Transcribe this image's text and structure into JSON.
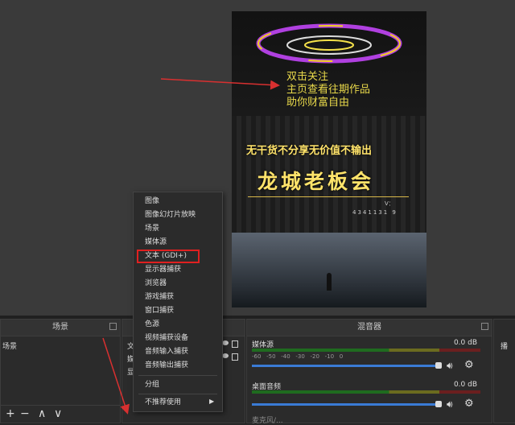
{
  "overlay_text": {
    "line1": "双击关注",
    "line2": "主页查看往期作品",
    "line3": "助你财富自由"
  },
  "banner": {
    "slogan": "无干货不分享无价值不输出",
    "title": "龙城老板会",
    "contact_label": "V：",
    "contact_number": "4341131 9"
  },
  "scenes_panel": {
    "title": "场景",
    "item": "场景",
    "buttons": [
      "+",
      "−",
      "∧",
      "∨"
    ]
  },
  "sources_panel": {
    "items": [
      "文",
      "媒",
      "显"
    ]
  },
  "mixer": {
    "title": "混音器",
    "channels": [
      {
        "name": "媒体源",
        "db": "0.0 dB"
      },
      {
        "name": "桌面音频",
        "db": "0.0 dB"
      },
      {
        "name": "麦克风/..."
      }
    ],
    "scale": [
      "-60",
      "-55",
      "-50",
      "-45",
      "-40",
      "-35",
      "-30",
      "-25",
      "-20",
      "-15",
      "-10",
      "-5",
      "0"
    ]
  },
  "right_panel": {
    "title": "播"
  },
  "context_menu": {
    "items": [
      "图像",
      "图像幻灯片放映",
      "场景",
      "媒体源",
      "文本 (GDI+)",
      "显示器捕获",
      "浏览器",
      "游戏捕获",
      "窗口捕获",
      "色源",
      "视频捕获设备",
      "音频输入捕获",
      "音频输出捕获"
    ],
    "group": "分组",
    "deprecated": "不推荐使用"
  },
  "colors": {
    "overlay_text": "#e8d84a",
    "highlight": "#e02020",
    "arrow": "#d83030"
  }
}
